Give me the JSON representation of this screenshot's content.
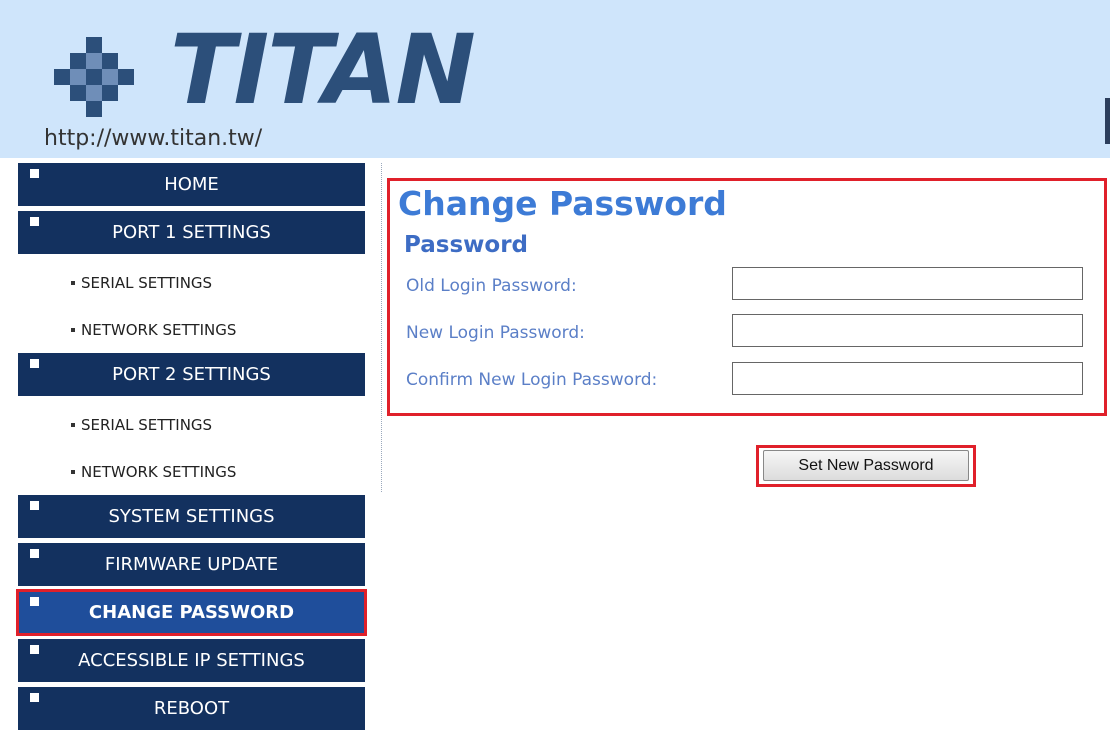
{
  "header": {
    "logo_text": "TITAN",
    "logo_url": "http://www.titan.tw/"
  },
  "sidebar": {
    "items": [
      {
        "label": "HOME",
        "type": "main"
      },
      {
        "label": "PORT 1 SETTINGS",
        "type": "main"
      },
      {
        "label": "SERIAL SETTINGS",
        "type": "sub"
      },
      {
        "label": "NETWORK SETTINGS",
        "type": "sub"
      },
      {
        "label": "PORT 2 SETTINGS",
        "type": "main"
      },
      {
        "label": "SERIAL SETTINGS",
        "type": "sub"
      },
      {
        "label": "NETWORK SETTINGS",
        "type": "sub"
      },
      {
        "label": "SYSTEM SETTINGS",
        "type": "main"
      },
      {
        "label": "FIRMWARE UPDATE",
        "type": "main"
      },
      {
        "label": "CHANGE PASSWORD",
        "type": "main",
        "active": true
      },
      {
        "label": "ACCESSIBLE IP SETTINGS",
        "type": "main"
      },
      {
        "label": "REBOOT",
        "type": "main"
      }
    ]
  },
  "main": {
    "title": "Change Password",
    "section_title": "Password",
    "fields": [
      {
        "label": "Old Login Password:",
        "value": ""
      },
      {
        "label": "New Login Password:",
        "value": ""
      },
      {
        "label": "Confirm New Login Password:",
        "value": ""
      }
    ],
    "submit_label": "Set New Password"
  },
  "colors": {
    "nav_background": "#13315f",
    "nav_active_background": "#1f4e9b",
    "header_background": "#cfe5fb",
    "title_blue": "#3d7bd6",
    "highlight_red": "#e0202a"
  }
}
